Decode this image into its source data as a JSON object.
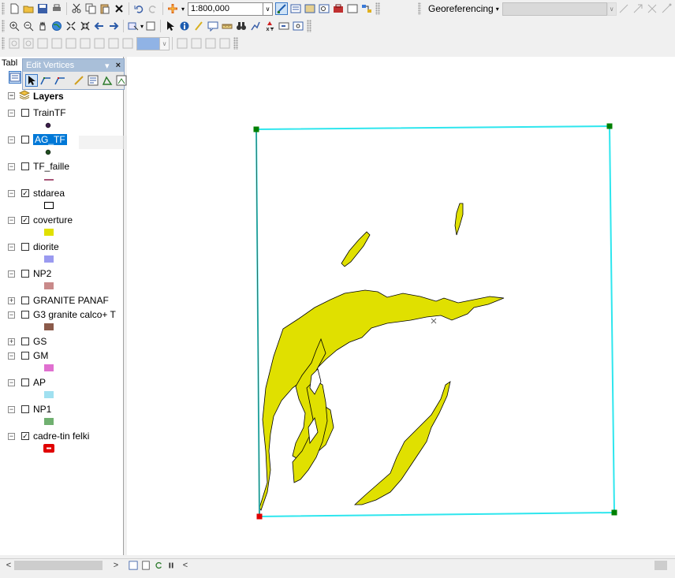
{
  "toolbar": {
    "scale_value": "1:800,000",
    "georeferencing_label": "Georeferencing"
  },
  "toc": {
    "title": "Tabl",
    "root_label": "Layers"
  },
  "edit_vertices": {
    "title": "Edit Vertices",
    "pin_glyph": "▾",
    "close_glyph": "×"
  },
  "layers": [
    {
      "name": "TrainTF",
      "checked": false,
      "expander": "−",
      "symbol": "dot-dark-purple",
      "color": "#3b1d4a"
    },
    {
      "name": "AG_TF",
      "checked": false,
      "expander": "−",
      "symbol": "dot-dark-green",
      "color": "#1f4d1f",
      "selected": true
    },
    {
      "name": "TF_faille",
      "checked": false,
      "expander": "−",
      "symbol": "line-maroon",
      "color": "#8b1e4a"
    },
    {
      "name": "stdarea",
      "checked": true,
      "expander": "−",
      "symbol": "hollow-rect",
      "color": "#ffffff"
    },
    {
      "name": "coverture",
      "checked": true,
      "expander": "−",
      "symbol": "fill-rect",
      "color": "#e0e000"
    },
    {
      "name": "diorite",
      "checked": false,
      "expander": "−",
      "symbol": "fill-rect",
      "color": "#9a9af0"
    },
    {
      "name": "NP2",
      "checked": false,
      "expander": "−",
      "symbol": "fill-rect",
      "color": "#c98a8a"
    },
    {
      "name": "GRANITE PANAF",
      "checked": false,
      "expander": "+",
      "symbol": "none",
      "color": ""
    },
    {
      "name": "G3 granite calco+ T",
      "checked": false,
      "expander": "−",
      "symbol": "fill-rect",
      "color": "#8b5a4a"
    },
    {
      "name": "GS",
      "checked": false,
      "expander": "+",
      "symbol": "none",
      "color": ""
    },
    {
      "name": "GM",
      "checked": false,
      "expander": "−",
      "symbol": "fill-rect",
      "color": "#e070d0"
    },
    {
      "name": "AP",
      "checked": false,
      "expander": "−",
      "symbol": "fill-rect",
      "color": "#a0e0f0"
    },
    {
      "name": "NP1",
      "checked": false,
      "expander": "−",
      "symbol": "fill-rect",
      "color": "#70b070"
    },
    {
      "name": "cadre-tin felki",
      "checked": true,
      "expander": "−",
      "symbol": "red-frame",
      "color": "#e00000"
    }
  ],
  "colors": {
    "frame": "#2ee6ee",
    "coverture_fill": "#e0e000",
    "vertex_green": "#008000",
    "vertex_red": "#e00000",
    "selection": "#0078d7"
  },
  "scroll": {
    "left_glyph": "<",
    "right_glyph": ">",
    "left_glyph_2": "<"
  }
}
